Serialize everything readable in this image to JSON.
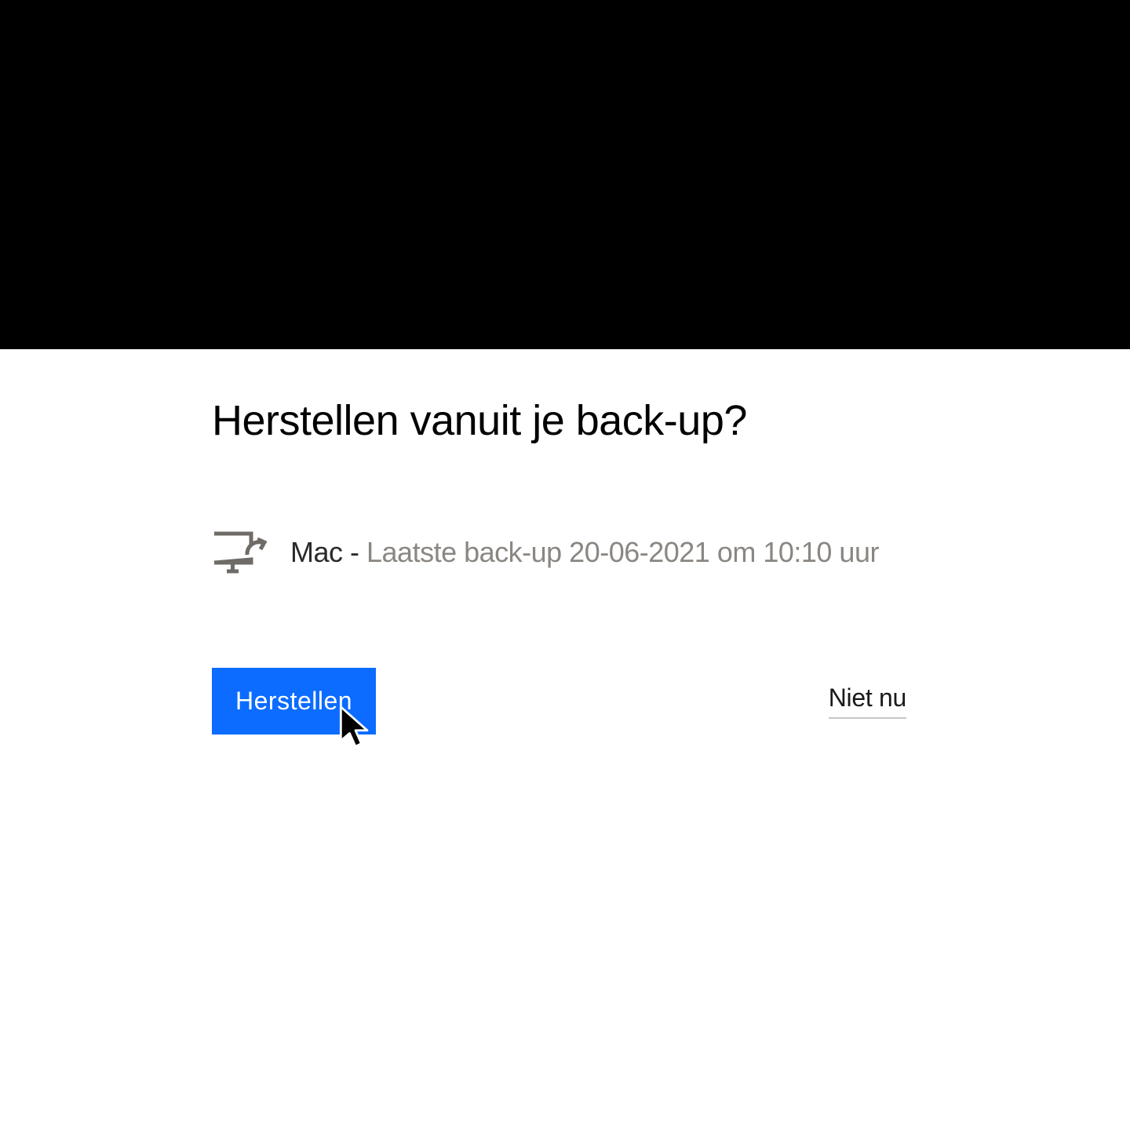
{
  "dialog": {
    "title": "Herstellen vanuit je back-up?",
    "device_name": "Mac",
    "separator": " - ",
    "backup_detail": "Laatste back-up 20-06-2021 om 10:10 uur"
  },
  "buttons": {
    "primary": "Herstellen",
    "secondary": "Niet nu"
  }
}
